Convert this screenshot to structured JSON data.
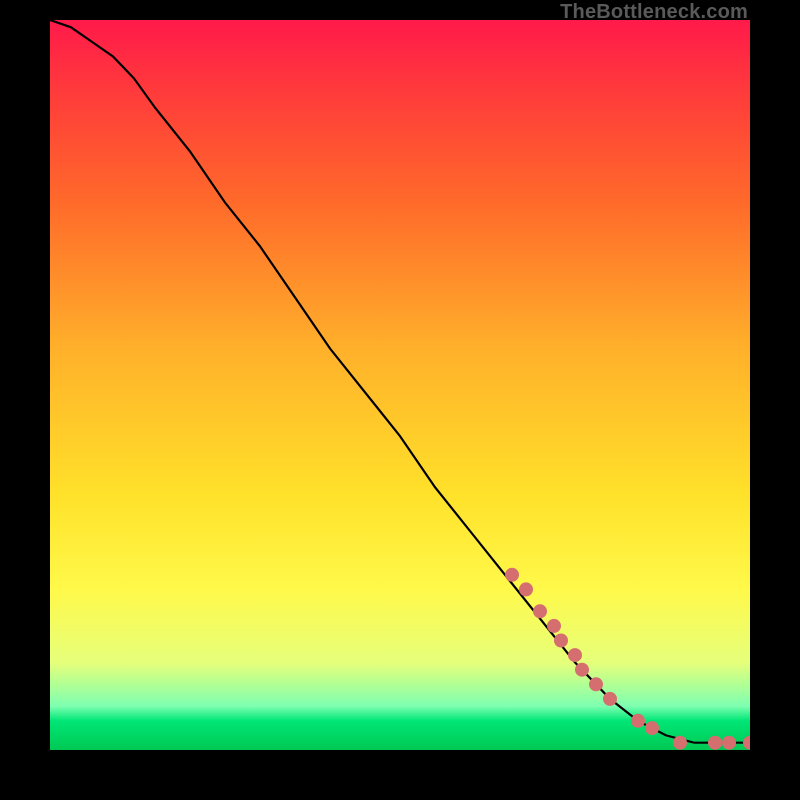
{
  "attribution": "TheBottleneck.com",
  "chart_data": {
    "type": "line",
    "title": "",
    "xlabel": "",
    "ylabel": "",
    "xlim": [
      0,
      100
    ],
    "ylim": [
      0,
      100
    ],
    "grid": false,
    "legend": false,
    "series": [
      {
        "name": "curve",
        "style": "line",
        "color": "#000000",
        "x": [
          0,
          3,
          6,
          9,
          12,
          15,
          20,
          25,
          30,
          35,
          40,
          45,
          50,
          55,
          60,
          65,
          70,
          75,
          80,
          84,
          88,
          92,
          95,
          97,
          99,
          100
        ],
        "y": [
          100,
          99,
          97,
          95,
          92,
          88,
          82,
          75,
          69,
          62,
          55,
          49,
          43,
          36,
          30,
          24,
          18,
          12,
          7,
          4,
          2,
          1,
          1,
          1,
          1,
          1
        ]
      },
      {
        "name": "highlight-points",
        "style": "scatter",
        "color": "#d56e6e",
        "x": [
          66,
          68,
          70,
          72,
          73,
          75,
          76,
          78,
          80,
          84,
          86,
          90,
          95,
          97,
          100
        ],
        "y": [
          24,
          22,
          19,
          17,
          15,
          13,
          11,
          9,
          7,
          4,
          3,
          1,
          1,
          1,
          1
        ]
      }
    ]
  }
}
